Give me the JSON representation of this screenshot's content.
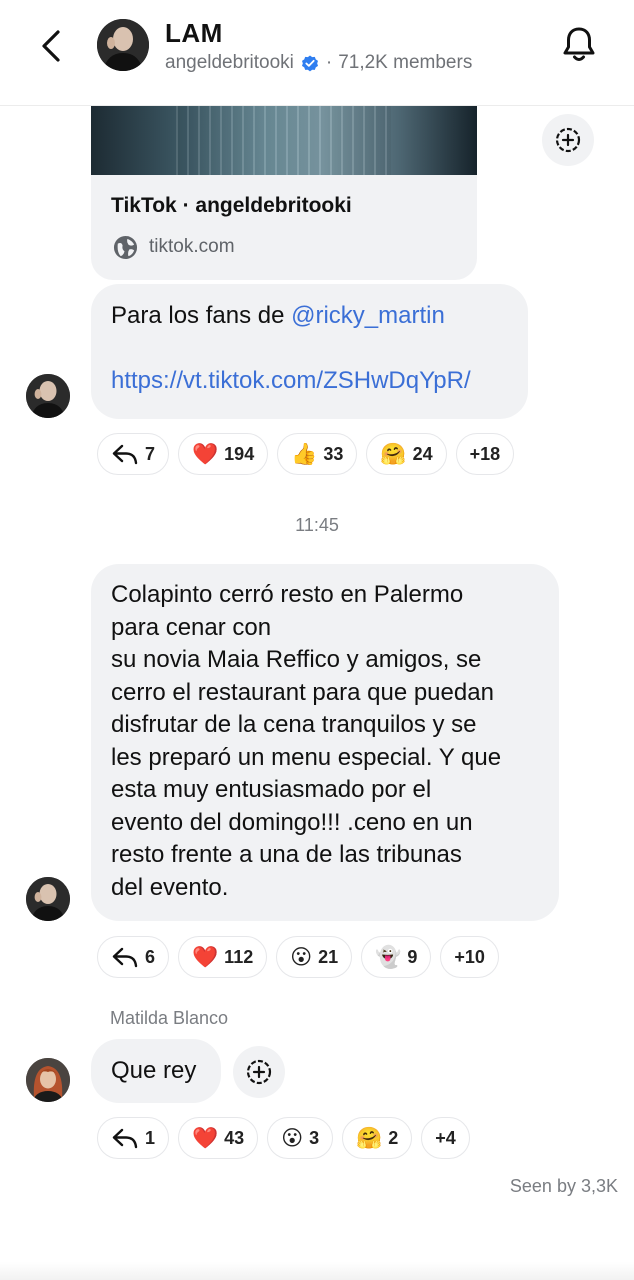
{
  "header": {
    "title": "LAM",
    "handle": "angeldebritooki",
    "members": "71,2K members"
  },
  "link_preview": {
    "title": "TikTok · angeldebritooki",
    "domain": "tiktok.com"
  },
  "messages": [
    {
      "text_prefix": "Para los fans de ",
      "mention": "@ricky_martin",
      "link": "https://vt.tiktok.com/ZSHwDqYpR/",
      "reactions": [
        {
          "icon": "reply-icon",
          "count": "7"
        },
        {
          "emoji": "❤️",
          "icon": "heart-emoji",
          "count": "194"
        },
        {
          "emoji": "👍",
          "icon": "thumbs-up-emoji",
          "count": "33"
        },
        {
          "emoji": "🤗",
          "icon": "hugging-face-emoji",
          "count": "24"
        },
        {
          "more": "+18"
        }
      ]
    },
    {
      "lines": [
        "Colapinto cerró resto en Palermo",
        "para cenar con",
        "su novia Maia Reffico y amigos, se",
        "cerro el restaurant para que puedan",
        "disfrutar de la cena tranquilos y se",
        "les preparó un menu especial. Y que",
        "esta muy entusiasmado por el",
        "evento del domingo!!! .ceno en un",
        "resto frente a una de las tribunas",
        "del evento."
      ],
      "reactions": [
        {
          "icon": "reply-icon",
          "count": "6"
        },
        {
          "emoji": "❤️",
          "icon": "heart-emoji",
          "count": "112"
        },
        {
          "emoji": "😮",
          "icon": "surprised-face-emoji",
          "count": "21"
        },
        {
          "emoji": "👻",
          "icon": "ghost-emoji",
          "count": "9"
        },
        {
          "more": "+10"
        }
      ]
    },
    {
      "sender": "Matilda Blanco",
      "text": "Que rey",
      "reactions": [
        {
          "icon": "reply-icon",
          "count": "1"
        },
        {
          "emoji": "❤️",
          "icon": "heart-emoji",
          "count": "43"
        },
        {
          "emoji": "😮",
          "icon": "surprised-face-emoji",
          "count": "3"
        },
        {
          "emoji": "🤗",
          "icon": "hugging-face-emoji",
          "count": "2"
        },
        {
          "more": "+4"
        }
      ]
    }
  ],
  "timestamp": "11:45",
  "seen": "Seen by 3,3K",
  "colors": {
    "link": "#3b6fd6",
    "verified": "#2f7ef0",
    "heart": "#e0162b"
  }
}
